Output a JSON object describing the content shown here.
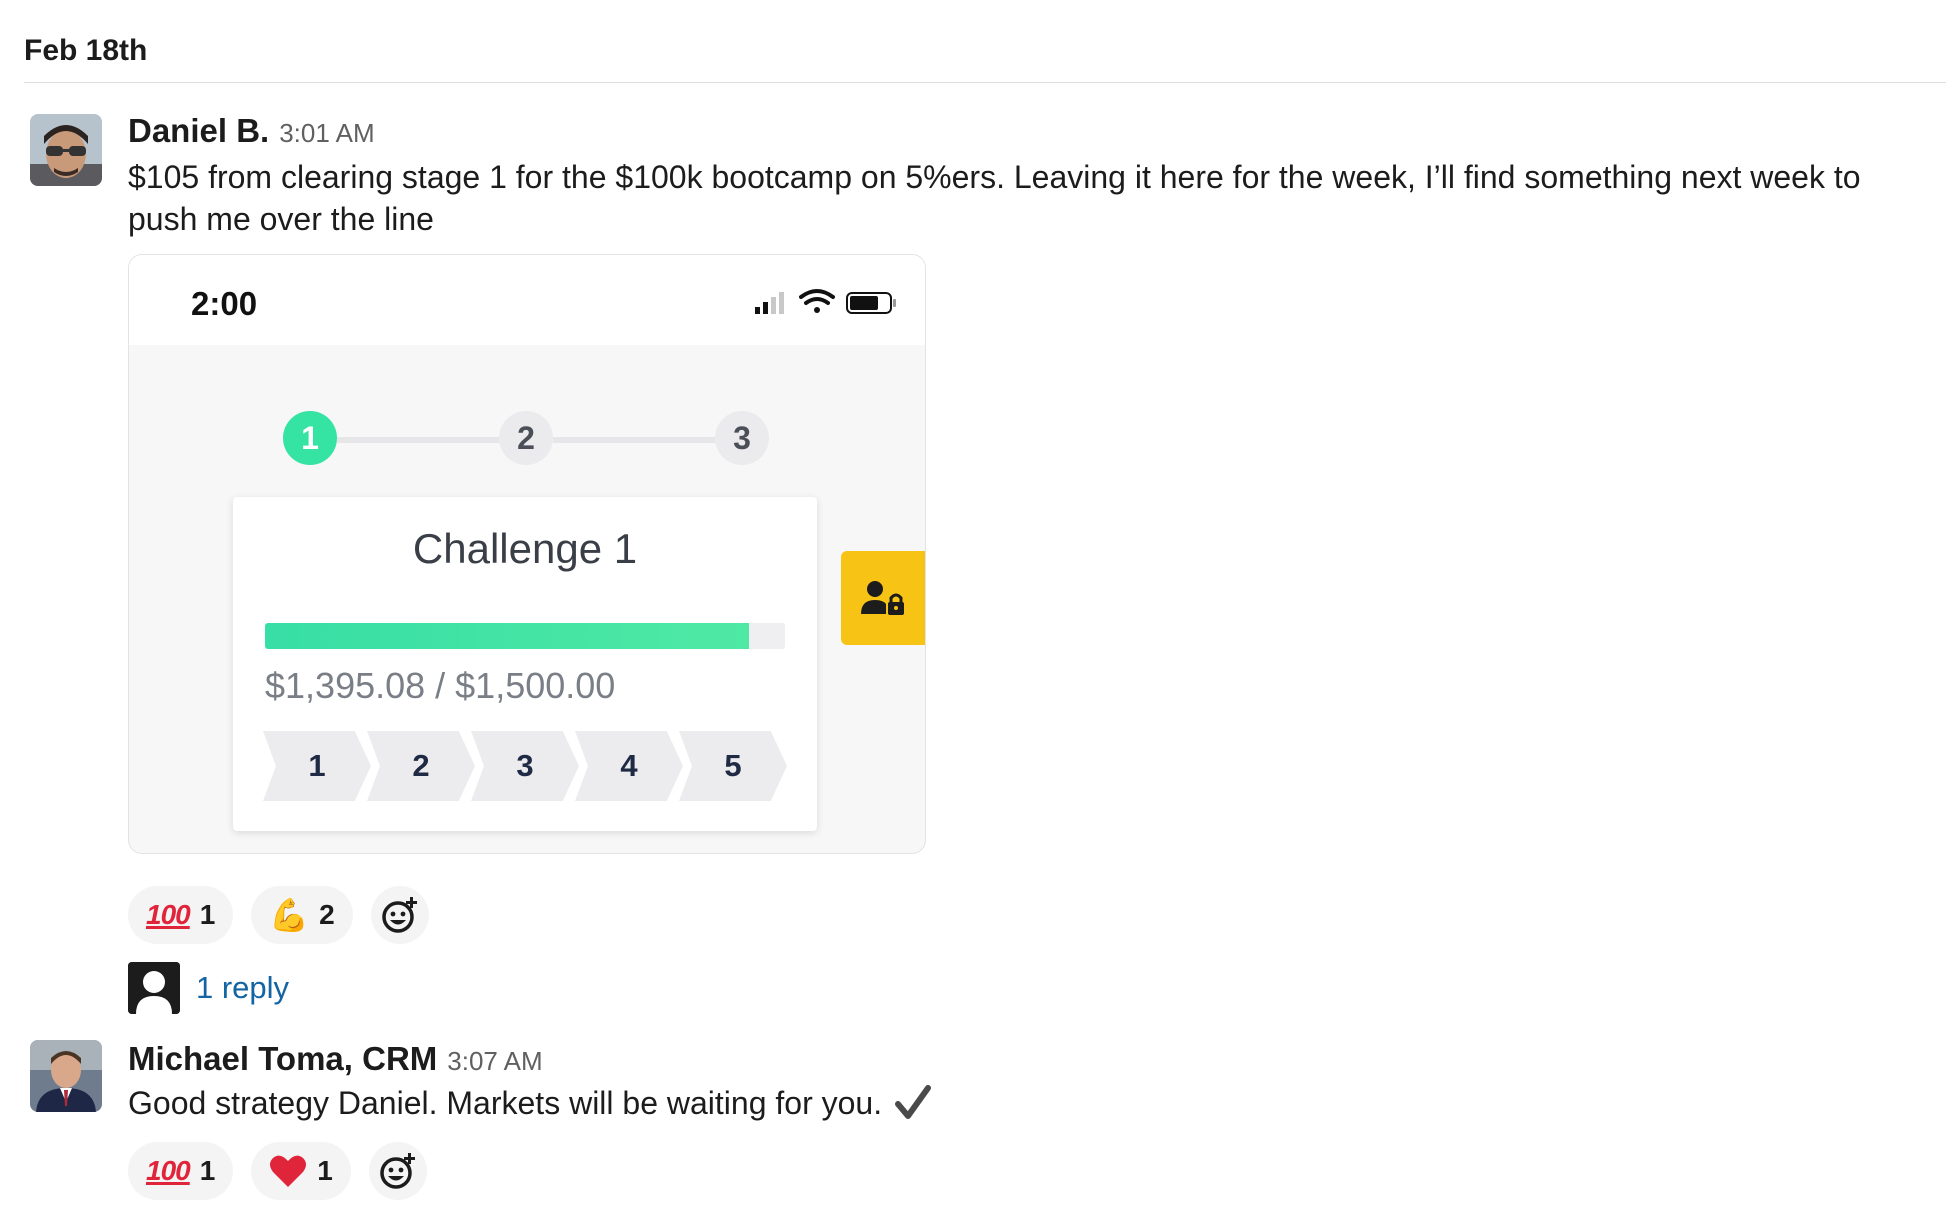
{
  "date_divider": "Feb 18th",
  "messages": [
    {
      "author": "Daniel B.",
      "time": "3:01 AM",
      "text": "$105 from clearing stage 1 for the $100k bootcamp on 5%ers. Leaving it here for the week, I’ll find something next week to push me over the line",
      "attachment": {
        "status_time": "2:00",
        "steps": [
          "1",
          "2",
          "3"
        ],
        "active_step": "1",
        "challenge_title": "Challenge 1",
        "progress_fraction": 0.93,
        "amount_text": "$1,395.08 / $1,500.00",
        "phases": [
          "1",
          "2",
          "3",
          "4",
          "5"
        ]
      },
      "reactions": [
        {
          "emoji": "100",
          "icon": "hundred-points-icon",
          "count": "1"
        },
        {
          "emoji": "💪",
          "icon": "flexed-biceps-icon",
          "count": "2"
        }
      ],
      "reply_text": "1 reply"
    },
    {
      "author": "Michael Toma, CRM",
      "time": "3:07 AM",
      "text": "Good strategy Daniel. Markets will be waiting for you.",
      "reactions": [
        {
          "emoji": "100",
          "icon": "hundred-points-icon",
          "count": "1"
        },
        {
          "emoji": "❤️",
          "icon": "red-heart-icon",
          "count": "1"
        }
      ]
    }
  ],
  "colors": {
    "accent_green": "#35e3a2",
    "lock_yellow": "#f7c416",
    "link_blue": "#1264a3"
  }
}
